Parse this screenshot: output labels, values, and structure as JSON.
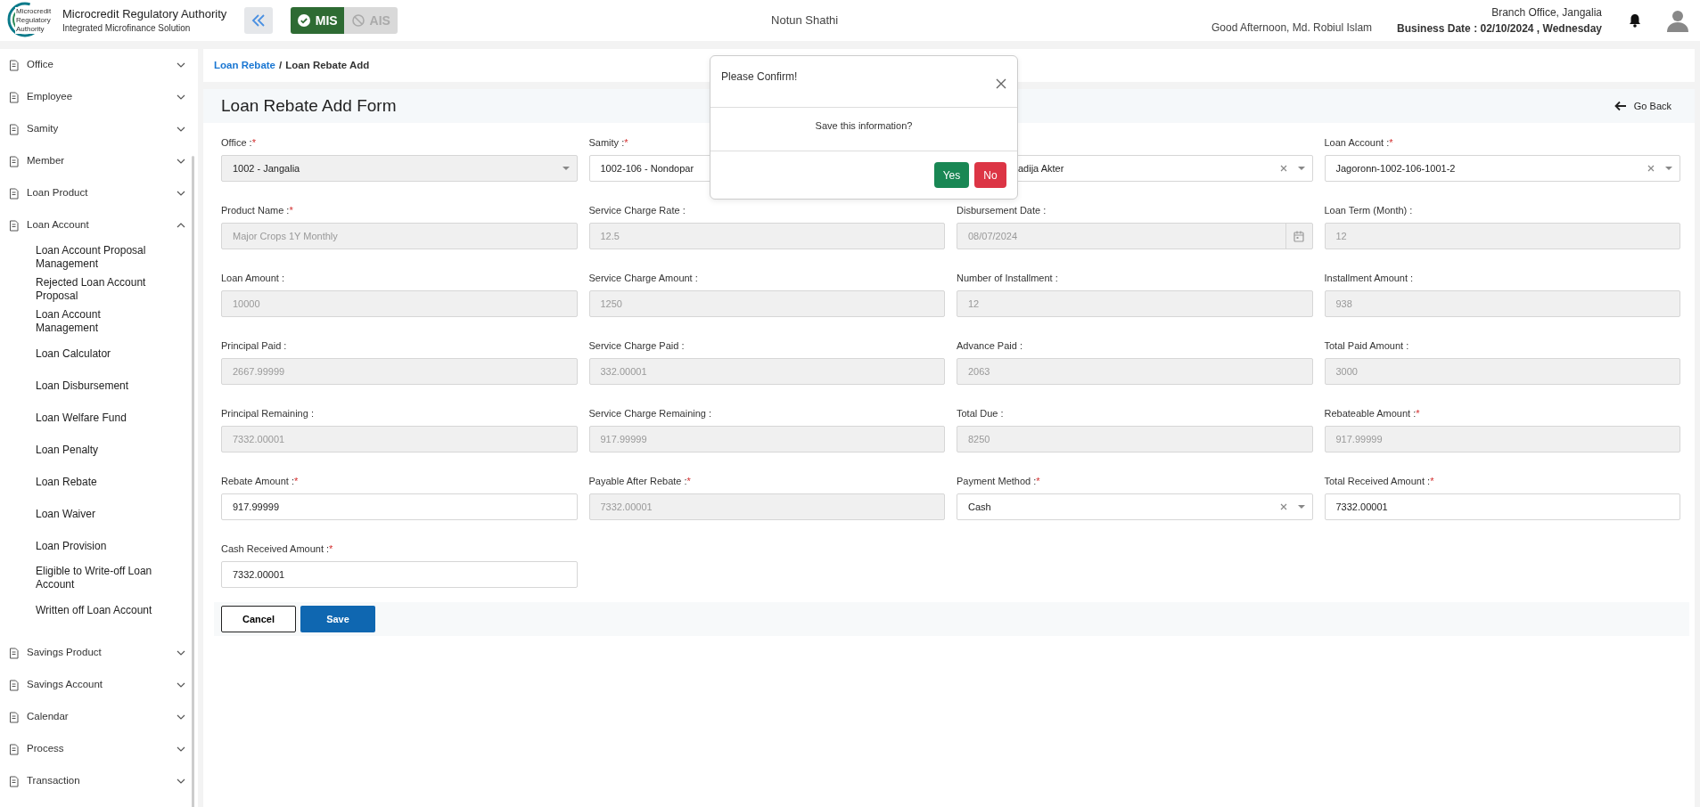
{
  "header": {
    "org_title": "Microcredit Regulatory Authority",
    "org_subtitle": "Integrated Microfinance Solution",
    "logo_text": [
      "Microcredit",
      "Regulatory",
      "Authority"
    ],
    "modules": [
      {
        "label": "MIS",
        "selected": true
      },
      {
        "label": "AIS",
        "selected": false
      }
    ],
    "center_title": "Notun Shathi",
    "greeting": "Good Afternoon, Md. Robiul Islam",
    "branch": "Branch Office, Jangalia",
    "business_date": "Business Date : 02/10/2024 , Wednesday"
  },
  "sidebar": {
    "items": [
      {
        "label": "Office",
        "expanded": false
      },
      {
        "label": "Employee",
        "expanded": false
      },
      {
        "label": "Samity",
        "expanded": false
      },
      {
        "label": "Member",
        "expanded": false
      },
      {
        "label": "Loan Product",
        "expanded": false
      },
      {
        "label": "Loan Account",
        "expanded": true,
        "children": [
          "Loan Account Proposal Management",
          "Rejected Loan Account Proposal",
          "Loan Account Management",
          "Loan Calculator",
          "Loan Disbursement",
          "Loan Welfare Fund",
          "Loan Penalty",
          "Loan Rebate",
          "Loan Waiver",
          "Loan Provision",
          "Eligible to Write-off Loan Account",
          "Written off Loan Account"
        ]
      },
      {
        "label": "Savings Product",
        "expanded": false
      },
      {
        "label": "Savings Account",
        "expanded": false
      },
      {
        "label": "Calendar",
        "expanded": false
      },
      {
        "label": "Process",
        "expanded": false
      },
      {
        "label": "Transaction",
        "expanded": false
      }
    ]
  },
  "breadcrumb": {
    "link": "Loan Rebate",
    "separator": "/",
    "current": "Loan Rebate Add"
  },
  "form": {
    "title": "Loan Rebate Add Form",
    "go_back": "Go Back",
    "fields": [
      {
        "kind": "select",
        "label": "Office :",
        "required_mark": "*",
        "value": "1002 - Jangalia",
        "disabled": true,
        "clearable": false
      },
      {
        "kind": "select",
        "label": "Samity :",
        "required_mark": "*",
        "value": "1002-106 - Nondopar",
        "disabled": false
      },
      {
        "kind": "select",
        "value": "adija Akter",
        "disabled": false,
        "clearable": true,
        "hidden_left": true
      },
      {
        "kind": "select",
        "label": "Loan Account :",
        "required_mark": "*",
        "value": "Jagoronn-1002-106-1001-2",
        "disabled": false,
        "clearable": true
      },
      {
        "kind": "text",
        "label": "Product Name :",
        "required_mark": "*",
        "value": "Major Crops 1Y Monthly",
        "disabled": true
      },
      {
        "kind": "text",
        "label": "Service Charge Rate :",
        "value": "12.5",
        "disabled": true
      },
      {
        "kind": "date",
        "label": "Disbursement Date :",
        "value": "08/07/2024",
        "disabled": true
      },
      {
        "kind": "text",
        "label": "Loan Term (Month) :",
        "value": "12",
        "disabled": true
      },
      {
        "kind": "text",
        "label": "Loan Amount :",
        "value": "10000",
        "disabled": true
      },
      {
        "kind": "text",
        "label": "Service Charge Amount :",
        "value": "1250",
        "disabled": true
      },
      {
        "kind": "text",
        "label": "Number of Installment :",
        "value": "12",
        "disabled": true
      },
      {
        "kind": "text",
        "label": "Installment Amount :",
        "value": "938",
        "disabled": true
      },
      {
        "kind": "text",
        "label": "Principal Paid :",
        "value": "2667.99999",
        "disabled": true
      },
      {
        "kind": "text",
        "label": "Service Charge Paid :",
        "value": "332.00001",
        "disabled": true
      },
      {
        "kind": "text",
        "label": "Advance Paid :",
        "value": "2063",
        "disabled": true
      },
      {
        "kind": "text",
        "label": "Total Paid Amount :",
        "value": "3000",
        "disabled": true
      },
      {
        "kind": "text",
        "label": "Principal Remaining :",
        "value": "7332.00001",
        "disabled": true
      },
      {
        "kind": "text",
        "label": "Service Charge Remaining :",
        "value": "917.99999",
        "disabled": true
      },
      {
        "kind": "text",
        "label": "Total Due :",
        "value": "8250",
        "disabled": true
      },
      {
        "kind": "text",
        "label": "Rebateable Amount :",
        "required_mark": "*",
        "value": "917.99999",
        "disabled": true
      },
      {
        "kind": "text",
        "label": "Rebate Amount :",
        "required_mark": "*",
        "value": "917.99999",
        "disabled": false
      },
      {
        "kind": "text",
        "label": "Payable After Rebate :",
        "required_mark": "*",
        "value": "7332.00001",
        "disabled": true
      },
      {
        "kind": "select",
        "label": "Payment Method :",
        "required_mark": "*",
        "value": "Cash",
        "disabled": false,
        "clearable": true
      },
      {
        "kind": "text",
        "label": "Total Received Amount :",
        "required_mark": "*",
        "value": "7332.00001",
        "disabled": false
      },
      {
        "kind": "text",
        "label": "Cash Received Amount :",
        "required_mark": "*",
        "value": "7332.00001",
        "disabled": false
      }
    ],
    "buttons": [
      {
        "label": "Cancel",
        "kind": "secondary"
      },
      {
        "label": "Save",
        "kind": "primary"
      }
    ]
  },
  "dialog": {
    "title": "Please Confirm!",
    "message": "Save this information?",
    "buttons": [
      {
        "label": "Yes",
        "kind": "confirm"
      },
      {
        "label": "No",
        "kind": "deny"
      }
    ]
  }
}
